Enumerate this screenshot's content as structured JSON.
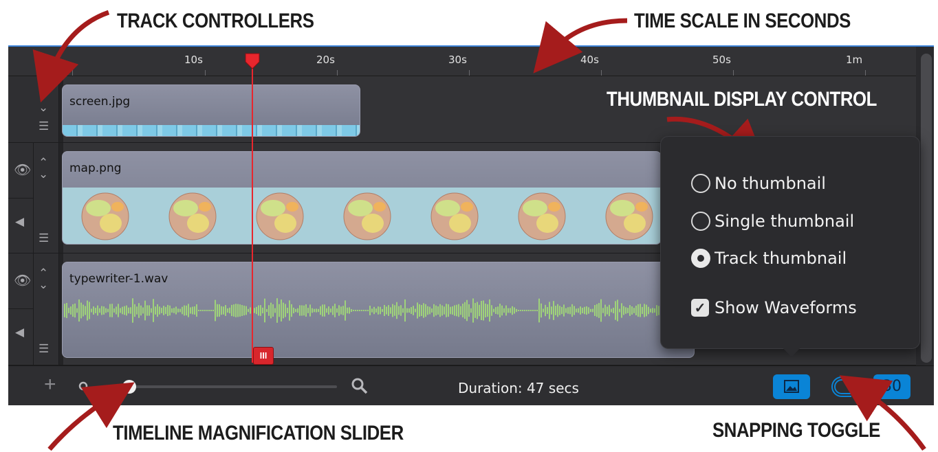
{
  "callouts": {
    "track_controllers": "TRACK CONTROLLERS",
    "time_scale": "TIME SCALE IN SECONDS",
    "thumbnail_display": "THUMBNAIL DISPLAY CONTROL",
    "magnification": "TIMELINE MAGNIFICATION SLIDER",
    "snapping": "SNAPPING TOGGLE"
  },
  "ruler": {
    "ticks": [
      "10s",
      "20s",
      "30s",
      "40s",
      "50s",
      "1m"
    ]
  },
  "tracks": [
    {
      "clip_name": "screen.jpg",
      "kind": "image"
    },
    {
      "clip_name": "map.png",
      "kind": "image"
    },
    {
      "clip_name": "typewriter-1.wav",
      "kind": "audio"
    }
  ],
  "popover": {
    "options": [
      "No thumbnail",
      "Single thumbnail",
      "Track thumbnail"
    ],
    "selected": "Track thumbnail",
    "show_waveforms_label": "Show Waveforms",
    "show_waveforms_checked": true
  },
  "bottom_bar": {
    "duration": "Duration: 47 secs",
    "fps": "30",
    "zoom_level": 0.1
  },
  "colors": {
    "accent": "#0a84d6",
    "playhead": "#e8262d",
    "arrow": "#a51c1c",
    "waveform": "#9fd37a"
  },
  "icons": {
    "eye": "eye-icon",
    "speaker": "speaker-icon",
    "menu": "menu-icon",
    "move": "updown-chevron-icon",
    "add": "plus-icon",
    "zoom_out": "magnifier-small-icon",
    "zoom_in": "magnifier-large-icon",
    "thumbnail": "image-icon",
    "snap": "magnet-icon"
  }
}
